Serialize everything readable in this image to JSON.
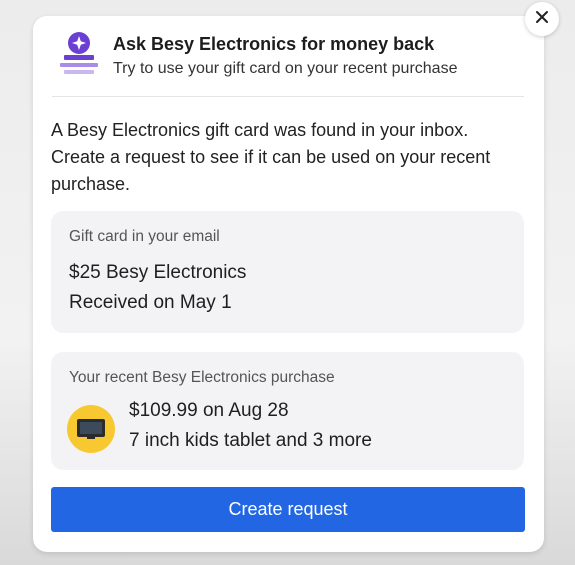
{
  "header": {
    "title": "Ask Besy Electronics for money back",
    "subtitle": "Try to use your gift card on your recent purchase",
    "icon": "refund-request-icon"
  },
  "message": "A Besy Electronics gift card was found in your inbox. Create a request to see if it can be used on your recent purchase.",
  "gift_card": {
    "label": "Gift card in your email",
    "amount_line": "$25 Besy Electronics",
    "received_line": "Received on May 1"
  },
  "purchase": {
    "label": "Your recent Besy Electronics purchase",
    "price_line": "$109.99 on Aug 28",
    "items_line": "7 inch kids tablet and 3 more",
    "thumb_icon": "tablet-icon"
  },
  "actions": {
    "create_label": "Create request",
    "close_icon": "close-icon"
  },
  "colors": {
    "primary_button": "#2266e3",
    "brand_purple": "#6b3fd1",
    "thumb_bg": "#f7c830",
    "box_bg": "#f3f3f5"
  }
}
